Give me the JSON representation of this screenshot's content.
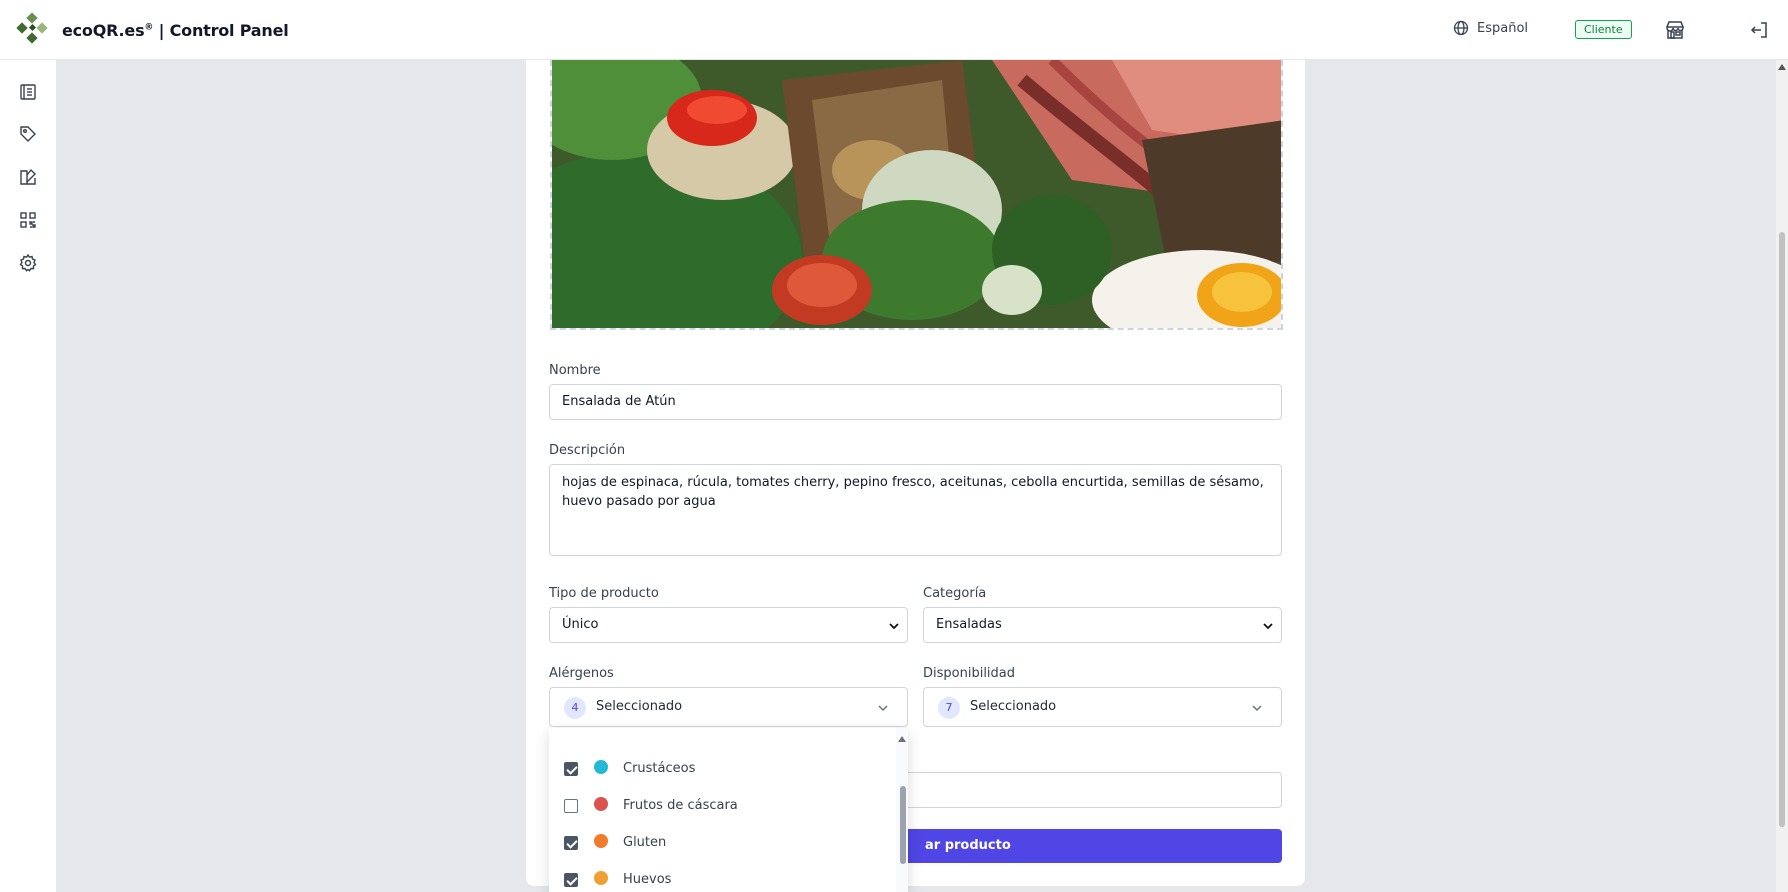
{
  "app": {
    "title": "ecoQR.es",
    "title_reg": "®",
    "title_suffix": " | Control Panel"
  },
  "header": {
    "language": "Español",
    "role_badge": "Cliente",
    "icons": [
      "globe-icon",
      "store-icon",
      "logout-icon"
    ]
  },
  "sidebar": {
    "items": [
      {
        "icon": "menu-book-icon"
      },
      {
        "icon": "tag-icon"
      },
      {
        "icon": "shapes-icon"
      },
      {
        "icon": "qr-code-icon"
      },
      {
        "icon": "settings-icon"
      }
    ]
  },
  "form": {
    "name_label": "Nombre",
    "name_value": "Ensalada de Atún",
    "description_label": "Descripción",
    "description_value": "hojas de espinaca, rúcula, tomates cherry, pepino fresco, aceitunas, cebolla encurtida, semillas de sésamo, huevo pasado por agua",
    "product_type_label": "Tipo de producto",
    "product_type_value": "Único",
    "category_label": "Categoría",
    "category_value": "Ensaladas",
    "allergens_label": "Alérgenos",
    "allergens_count": "4",
    "allergens_text": "Seleccionado",
    "availability_label": "Disponibilidad",
    "availability_count": "7",
    "availability_text": "Seleccionado",
    "submit_label_visible": "ar producto"
  },
  "allergen_dropdown": {
    "items": [
      {
        "label": "Crustáceos",
        "checked": true,
        "color": "#22b8d6"
      },
      {
        "label": "Frutos de cáscara",
        "checked": false,
        "color": "#d9534f"
      },
      {
        "label": "Gluten",
        "checked": true,
        "color": "#f07b2b"
      },
      {
        "label": "Huevos",
        "checked": true,
        "color": "#f0a030"
      }
    ]
  },
  "colors": {
    "accent": "#4f46e5",
    "badge_green": "#15803d",
    "logo_green": "#3f6b2f"
  }
}
